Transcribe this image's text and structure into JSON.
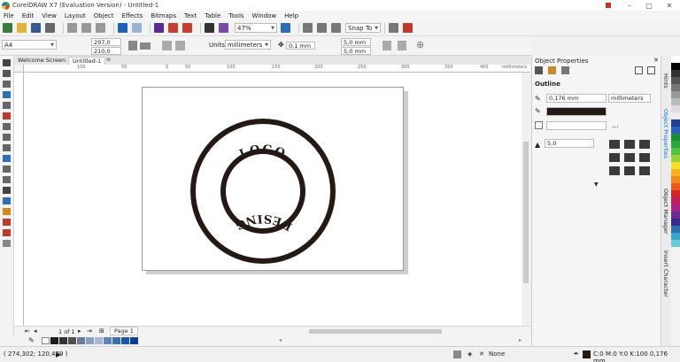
{
  "window": {
    "title": "CorelDRAW X7 (Evaluation Version) - Untitled-1"
  },
  "menu": [
    "File",
    "Edit",
    "View",
    "Layout",
    "Object",
    "Effects",
    "Bitmaps",
    "Text",
    "Table",
    "Tools",
    "Window",
    "Help"
  ],
  "toolbar": {
    "zoom": "47%",
    "snap": "Snap To"
  },
  "properties": {
    "paper": "A4",
    "width": "297,0 mm",
    "height": "210,0 mm",
    "units_label": "Units:",
    "units": "millimeters",
    "nudge": "0,1 mm",
    "dup_x": "5,0 mm",
    "dup_y": "5,0 mm"
  },
  "tabs": [
    {
      "label": "Welcome Screen"
    },
    {
      "label": "Untitled-1"
    }
  ],
  "ruler": {
    "h": [
      "100",
      "50",
      "0",
      "50",
      "100",
      "150",
      "200",
      "250",
      "300",
      "350",
      "400",
      "millimeters"
    ]
  },
  "logo": {
    "top": "LOGO",
    "bottom": "DESING"
  },
  "page_nav": {
    "count": "1 of 1",
    "page": "Page 1"
  },
  "status": {
    "coords": "( 274,302; 120,479 )",
    "fill": "None",
    "outline": "C:0 M:0 Y:0 K:100  0,176 mm"
  },
  "docker": {
    "title": "Object Properties",
    "section": "Outline",
    "width": "0,176 mm",
    "units": "millimeters",
    "miter": "5,0",
    "more": "..."
  },
  "dock_tabs": [
    "Hints",
    "Object Properties",
    "Object Manager",
    "Insert Character"
  ],
  "colors": {
    "accent": "#0078d7",
    "strip": [
      "#ffffff",
      "#000000",
      "#333333",
      "#555555",
      "#777777",
      "#999999",
      "#bbbbbb",
      "#dddddd",
      "#eeeeee",
      "#1f3f8f",
      "#2a5fc0",
      "#1a8d3a",
      "#27a83a",
      "#56c13c",
      "#9ad13b",
      "#f3e22b",
      "#f4b51d",
      "#f08a1c",
      "#e8581f",
      "#d1262a",
      "#c01f5a",
      "#a52585",
      "#6b2b8f",
      "#3a2a8e",
      "#2d6fa8",
      "#3ba6c8",
      "#6ccbd9"
    ],
    "palette": [
      "#ffffff",
      "#000000",
      "#333333",
      "#505050",
      "#6a7c9a",
      "#8aa0c0",
      "#a7b7d3",
      "#5f84bb",
      "#3a6db3",
      "#1c56a8",
      "#0b3f8f"
    ]
  }
}
